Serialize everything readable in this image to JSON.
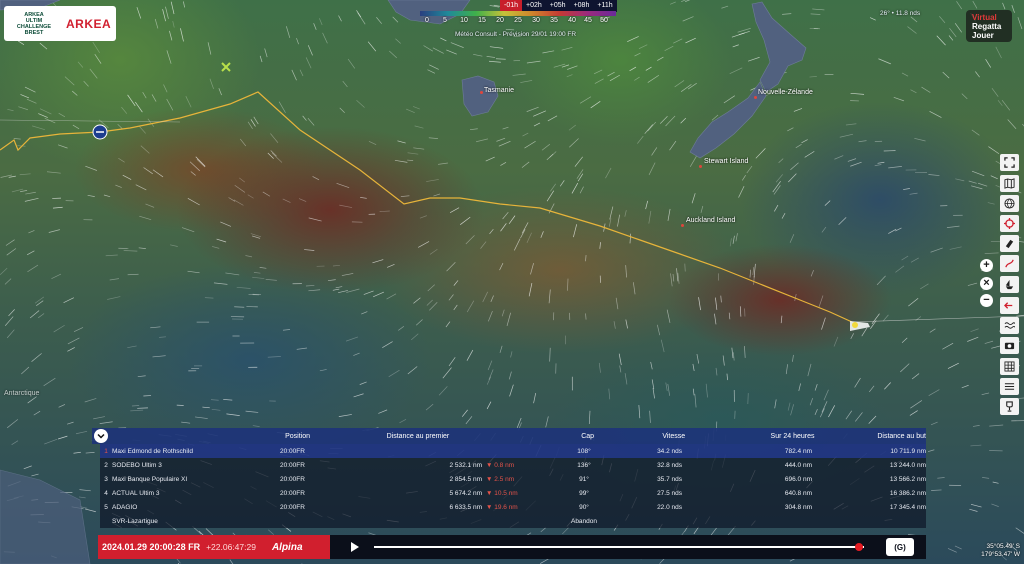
{
  "colors": {
    "accent_red": "#d11f2e",
    "panel_blue": "#1d3478",
    "route_yellow": "#e7b43a"
  },
  "logo": {
    "event_line1": "ARKEA",
    "event_line2": "ULTIM",
    "event_line3": "CHALLENGE",
    "event_line4": "BREST",
    "brand": "ARKEA"
  },
  "time_tabs": [
    "-01h",
    "+02h",
    "+05h",
    "+08h",
    "+11h"
  ],
  "wind_scale": [
    "0",
    "5",
    "10",
    "15",
    "20",
    "25",
    "30",
    "35",
    "40",
    "45",
    "50"
  ],
  "forecast_text": "Météo Consult - Prévision 29/01 19:00 FR",
  "wind_readout": "26° • 11.8 nds",
  "game_logo": {
    "line1": "Virtual",
    "line2": "Regatta",
    "line3": "Jouer"
  },
  "places": [
    {
      "name": "Tasmanie"
    },
    {
      "name": "Nouvelle-Zélande"
    },
    {
      "name": "Stewart Island"
    },
    {
      "name": "Auckland Island"
    },
    {
      "name": "Antarctique"
    }
  ],
  "toolbar_icons": [
    "fullscreen-icon",
    "map-icon",
    "globe-icon",
    "target-icon",
    "eraser-icon",
    "route-icon",
    "boat-icon",
    "wind-layer-icon",
    "wave-icon",
    "camera-icon",
    "grid-icon",
    "list-icon",
    "trophy-icon"
  ],
  "zoom": {
    "in": "+",
    "reset": "×",
    "out": "−"
  },
  "ranking": {
    "headers": {
      "position": "Position",
      "distance_first": "Distance au premier",
      "cap": "Cap",
      "speed": "Vitesse",
      "last24": "Sur 24 heures",
      "distance_goal": "Distance au but"
    },
    "rows": [
      {
        "rank": "1",
        "name": "Maxi Edmond de Rothschild",
        "position": "20:00FR",
        "distance": "",
        "delta": "",
        "cap": "108°",
        "speed": "34.2 nds",
        "last24": "782.4 nm",
        "goal": "10 711.9 nm"
      },
      {
        "rank": "2",
        "name": "SODEBO Ultim 3",
        "position": "20:00FR",
        "distance": "2 532.1 nm",
        "delta": "▼ 0.8 nm",
        "cap": "136°",
        "speed": "32.8 nds",
        "last24": "444.0 nm",
        "goal": "13 244.0 nm"
      },
      {
        "rank": "3",
        "name": "Maxi Banque Populaire XI",
        "position": "20:00FR",
        "distance": "2 854.5 nm",
        "delta": "▼ 2.5 nm",
        "cap": "91°",
        "speed": "35.7 nds",
        "last24": "696.0 nm",
        "goal": "13 566.2 nm"
      },
      {
        "rank": "4",
        "name": "ACTUAL Ultim 3",
        "position": "20:00FR",
        "distance": "5 674.2 nm",
        "delta": "▼ 10.5 nm",
        "cap": "99°",
        "speed": "27.5 nds",
        "last24": "640.8 nm",
        "goal": "16 386.2 nm"
      },
      {
        "rank": "5",
        "name": "ADAGIO",
        "position": "20:00FR",
        "distance": "6 633.5 nm",
        "delta": "▼ 19.6 nm",
        "cap": "90°",
        "speed": "22.0 nds",
        "last24": "304.8 nm",
        "goal": "17 345.4 nm"
      },
      {
        "rank": "",
        "name": "SVR-Lazartigue",
        "position": "",
        "distance": "",
        "delta": "",
        "cap": "Abandon",
        "speed": "",
        "last24": "",
        "goal": ""
      }
    ]
  },
  "playback": {
    "date": "2024.01.29 20:00:28 FR",
    "elapsed": "+22.06:47:29",
    "sponsor": "Alpina",
    "speed_label": "(G)",
    "progress": 0.99
  },
  "coords": {
    "lat": "35°05.49' S",
    "lon": "179°53.47' W"
  }
}
